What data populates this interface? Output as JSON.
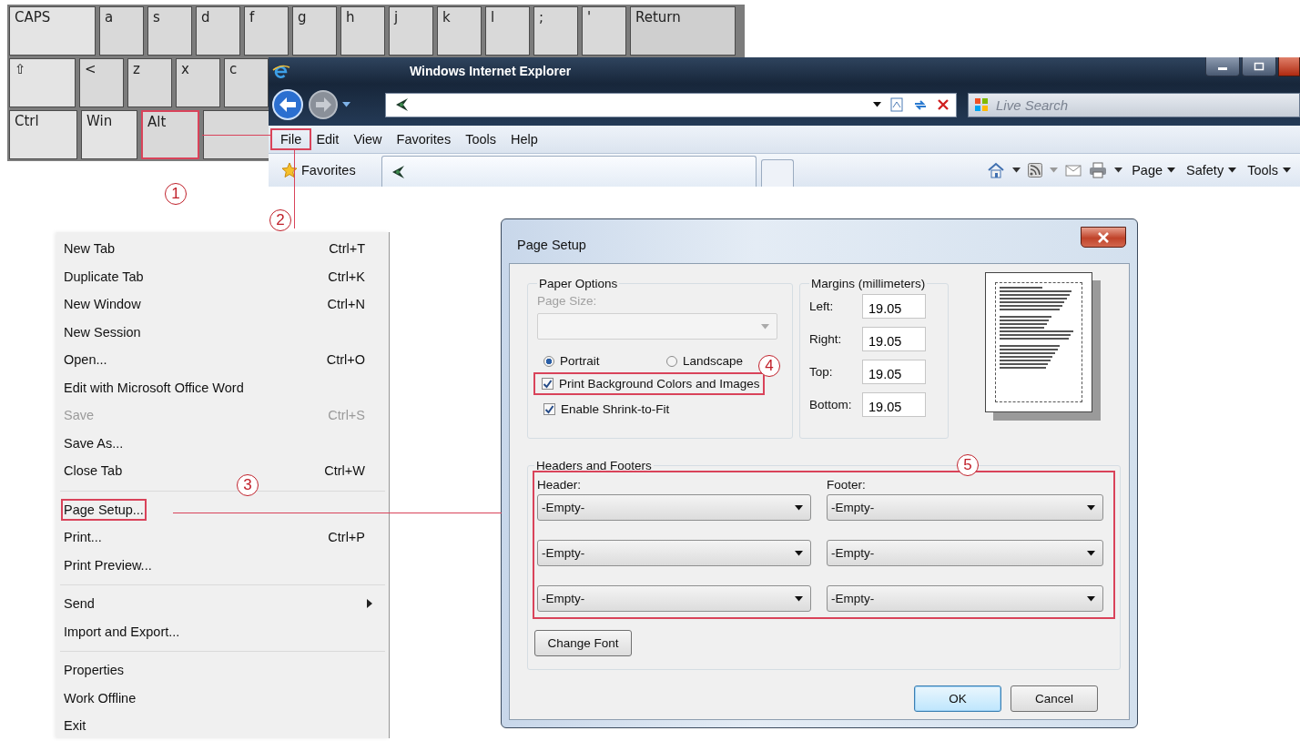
{
  "keyboard": {
    "rows": [
      [
        {
          "label": "CAPS",
          "highlighted": false
        },
        {
          "label": "a",
          "highlighted": false
        },
        {
          "label": "s",
          "highlighted": false
        },
        {
          "label": "d",
          "highlighted": false
        },
        {
          "label": "f",
          "highlighted": false
        },
        {
          "label": "g",
          "highlighted": false
        },
        {
          "label": "h",
          "highlighted": false
        },
        {
          "label": "j",
          "highlighted": false
        },
        {
          "label": "k",
          "highlighted": false
        },
        {
          "label": "l",
          "highlighted": false
        },
        {
          "label": ";",
          "highlighted": false
        },
        {
          "label": "'",
          "highlighted": false
        },
        {
          "label": "Return",
          "highlighted": false
        }
      ],
      [
        {
          "label": "⇧",
          "highlighted": false
        },
        {
          "label": "<",
          "highlighted": false
        },
        {
          "label": "z",
          "highlighted": false
        },
        {
          "label": "x",
          "highlighted": false
        },
        {
          "label": "c",
          "highlighted": false
        }
      ],
      [
        {
          "label": "Ctrl",
          "highlighted": false
        },
        {
          "label": "Win",
          "highlighted": false
        },
        {
          "label": "Alt",
          "highlighted": true
        },
        {
          "highlighted": false
        }
      ]
    ]
  },
  "browser": {
    "title": "Windows Internet Explorer",
    "search": {
      "placeholder": "Live Search"
    },
    "menu_bar": [
      {
        "label": "File",
        "highlighted": true
      },
      {
        "label": "Edit",
        "highlighted": false
      },
      {
        "label": "View",
        "highlighted": false
      },
      {
        "label": "Favorites",
        "highlighted": false
      },
      {
        "label": "Tools",
        "highlighted": false
      },
      {
        "label": "Help",
        "highlighted": false
      }
    ],
    "favorites_button": "Favorites",
    "command_bar": [
      "Page",
      "Safety",
      "Tools"
    ]
  },
  "file_menu": {
    "items": [
      {
        "kind": "item",
        "label": "New Tab",
        "shortcut": "Ctrl+T",
        "disabled": false,
        "highlighted": false
      },
      {
        "kind": "item",
        "label": "Duplicate Tab",
        "shortcut": "Ctrl+K",
        "disabled": false,
        "highlighted": false
      },
      {
        "kind": "item",
        "label": "New Window",
        "shortcut": "Ctrl+N",
        "disabled": false,
        "highlighted": false
      },
      {
        "kind": "item",
        "label": "New Session",
        "disabled": false,
        "highlighted": false
      },
      {
        "kind": "item",
        "label": "Open...",
        "shortcut": "Ctrl+O",
        "disabled": false,
        "highlighted": false
      },
      {
        "kind": "item",
        "label": "Edit with Microsoft Office Word",
        "disabled": false,
        "highlighted": false
      },
      {
        "kind": "item",
        "label": "Save",
        "shortcut": "Ctrl+S",
        "disabled": true,
        "highlighted": false
      },
      {
        "kind": "item",
        "label": "Save As...",
        "disabled": false,
        "highlighted": false
      },
      {
        "kind": "item",
        "label": "Close Tab",
        "shortcut": "Ctrl+W",
        "disabled": false,
        "highlighted": false
      },
      {
        "kind": "separator"
      },
      {
        "kind": "item",
        "label": "Page Setup...",
        "disabled": false,
        "highlighted": true
      },
      {
        "kind": "item",
        "label": "Print...",
        "shortcut": "Ctrl+P",
        "disabled": false,
        "highlighted": false
      },
      {
        "kind": "item",
        "label": "Print Preview...",
        "disabled": false,
        "highlighted": false
      },
      {
        "kind": "separator"
      },
      {
        "kind": "submenu",
        "label": "Send",
        "disabled": false,
        "highlighted": false
      },
      {
        "kind": "item",
        "label": "Import and Export...",
        "disabled": false,
        "highlighted": false
      },
      {
        "kind": "separator"
      },
      {
        "kind": "item",
        "label": "Properties",
        "disabled": false,
        "highlighted": false
      },
      {
        "kind": "item",
        "label": "Work Offline",
        "disabled": false,
        "highlighted": false
      },
      {
        "kind": "item",
        "label": "Exit",
        "disabled": false,
        "highlighted": false
      }
    ]
  },
  "page_setup": {
    "title": "Page Setup",
    "paper_options": {
      "title": "Paper Options",
      "page_size_label": "Page Size:",
      "disabled": true,
      "orientations": [
        {
          "label": "Portrait",
          "selected": true
        },
        {
          "label": "Landscape",
          "selected": false
        }
      ],
      "checkboxes": [
        {
          "label": "Print Background Colors and Images",
          "checked": true,
          "highlighted": true
        },
        {
          "label": "Enable Shrink-to-Fit",
          "checked": true,
          "highlighted": false
        }
      ]
    },
    "margins": {
      "title": "Margins (millimeters)",
      "fields": [
        {
          "label": "Left:",
          "value": "19.05"
        },
        {
          "label": "Right:",
          "value": "19.05"
        },
        {
          "label": "Top:",
          "value": "19.05"
        },
        {
          "label": "Bottom:",
          "value": "19.05"
        }
      ]
    },
    "headers_footers": {
      "title": "Headers and Footers",
      "highlighted": true,
      "header_label": "Header:",
      "footer_label": "Footer:",
      "headers": [
        "-Empty-",
        "-Empty-",
        "-Empty-"
      ],
      "footers": [
        "-Empty-",
        "-Empty-",
        "-Empty-"
      ]
    },
    "change_font_button": "Change Font",
    "buttons": [
      {
        "label": "OK",
        "default": true
      },
      {
        "label": "Cancel",
        "default": false
      }
    ]
  },
  "step_markers": [
    {
      "label": "1"
    },
    {
      "label": "2"
    },
    {
      "label": "3"
    },
    {
      "label": "4"
    },
    {
      "label": "5"
    }
  ]
}
